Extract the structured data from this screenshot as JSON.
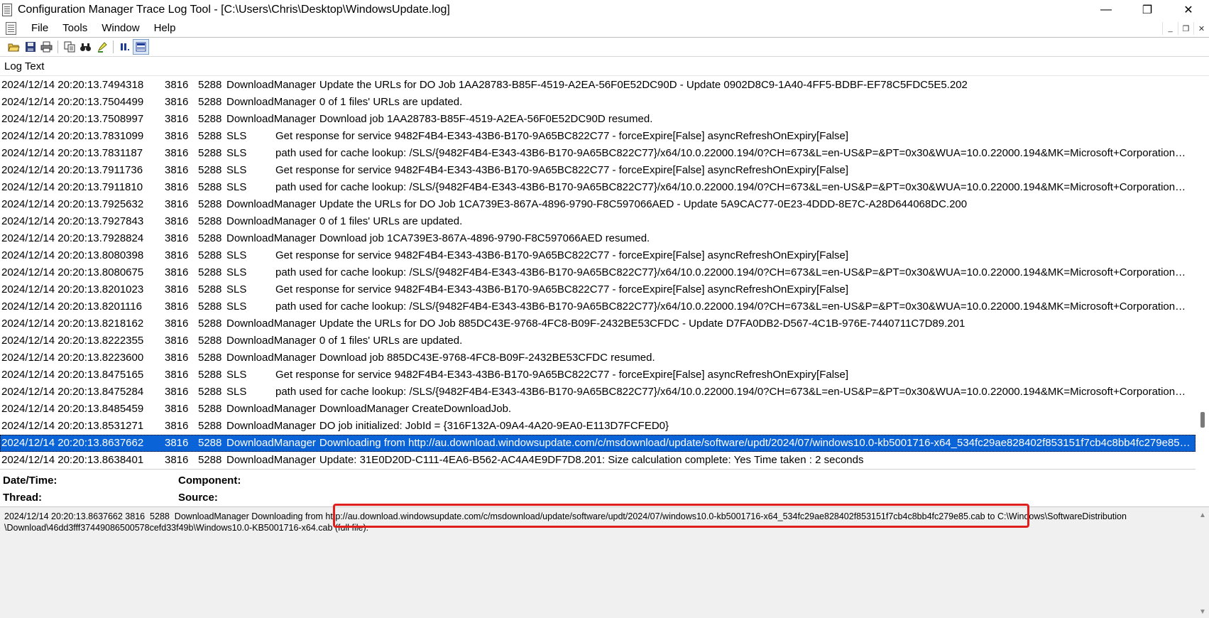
{
  "window": {
    "title": "Configuration Manager Trace Log Tool - [C:\\Users\\Chris\\Desktop\\WindowsUpdate.log]",
    "minimize": "—",
    "maximize": "❐",
    "close": "✕"
  },
  "menu": {
    "items": [
      "File",
      "Tools",
      "Window",
      "Help"
    ],
    "mdi_minimize": "_",
    "mdi_restore": "❐",
    "mdi_close": "✕"
  },
  "toolbar": {
    "icons": [
      "open-folder-icon",
      "save-icon",
      "print-icon",
      "copy-icon",
      "find-icon",
      "highlight-icon",
      "pause-icon",
      "details-pane-icon"
    ]
  },
  "log": {
    "header": "Log Text",
    "rows": [
      {
        "dt": "2024/12/14 20:20:13.7494318",
        "th": "3816",
        "pid": "5288",
        "comp": "DownloadManager",
        "text": "Update the URLs for DO Job 1AA28783-B85F-4519-A2EA-56F0E52DC90D - Update 0902D8C9-1A40-4FF5-BDBF-EF78C5FDC5E5.202"
      },
      {
        "dt": "2024/12/14 20:20:13.7504499",
        "th": "3816",
        "pid": "5288",
        "comp": "DownloadManager",
        "text": "0 of 1 files' URLs are updated."
      },
      {
        "dt": "2024/12/14 20:20:13.7508997",
        "th": "3816",
        "pid": "5288",
        "comp": "DownloadManager",
        "text": "Download job 1AA28783-B85F-4519-A2EA-56F0E52DC90D resumed."
      },
      {
        "dt": "2024/12/14 20:20:13.7831099",
        "th": "3816",
        "pid": "5288",
        "comp": "SLS",
        "text": "Get response for service 9482F4B4-E343-43B6-B170-9A65BC822C77 - forceExpire[False] asyncRefreshOnExpiry[False]"
      },
      {
        "dt": "2024/12/14 20:20:13.7831187",
        "th": "3816",
        "pid": "5288",
        "comp": "SLS",
        "text": "path used for cache lookup: /SLS/{9482F4B4-E343-43B6-B170-9A65BC822C77}/x64/10.0.22000.194/0?CH=673&L=en-US&P=&PT=0x30&WUA=10.0.22000.194&MK=Microsoft+Corporation&MD=Virtual+Machine"
      },
      {
        "dt": "2024/12/14 20:20:13.7911736",
        "th": "3816",
        "pid": "5288",
        "comp": "SLS",
        "text": "Get response for service 9482F4B4-E343-43B6-B170-9A65BC822C77 - forceExpire[False] asyncRefreshOnExpiry[False]"
      },
      {
        "dt": "2024/12/14 20:20:13.7911810",
        "th": "3816",
        "pid": "5288",
        "comp": "SLS",
        "text": "path used for cache lookup: /SLS/{9482F4B4-E343-43B6-B170-9A65BC822C77}/x64/10.0.22000.194/0?CH=673&L=en-US&P=&PT=0x30&WUA=10.0.22000.194&MK=Microsoft+Corporation&MD=Virtual+Machine"
      },
      {
        "dt": "2024/12/14 20:20:13.7925632",
        "th": "3816",
        "pid": "5288",
        "comp": "DownloadManager",
        "text": "Update the URLs for DO Job 1CA739E3-867A-4896-9790-F8C597066AED - Update 5A9CAC77-0E23-4DDD-8E7C-A28D644068DC.200"
      },
      {
        "dt": "2024/12/14 20:20:13.7927843",
        "th": "3816",
        "pid": "5288",
        "comp": "DownloadManager",
        "text": "0 of 1 files' URLs are updated."
      },
      {
        "dt": "2024/12/14 20:20:13.7928824",
        "th": "3816",
        "pid": "5288",
        "comp": "DownloadManager",
        "text": "Download job 1CA739E3-867A-4896-9790-F8C597066AED resumed."
      },
      {
        "dt": "2024/12/14 20:20:13.8080398",
        "th": "3816",
        "pid": "5288",
        "comp": "SLS",
        "text": "Get response for service 9482F4B4-E343-43B6-B170-9A65BC822C77 - forceExpire[False] asyncRefreshOnExpiry[False]"
      },
      {
        "dt": "2024/12/14 20:20:13.8080675",
        "th": "3816",
        "pid": "5288",
        "comp": "SLS",
        "text": "path used for cache lookup: /SLS/{9482F4B4-E343-43B6-B170-9A65BC822C77}/x64/10.0.22000.194/0?CH=673&L=en-US&P=&PT=0x30&WUA=10.0.22000.194&MK=Microsoft+Corporation&MD=Virtual+Machine"
      },
      {
        "dt": "2024/12/14 20:20:13.8201023",
        "th": "3816",
        "pid": "5288",
        "comp": "SLS",
        "text": "Get response for service 9482F4B4-E343-43B6-B170-9A65BC822C77 - forceExpire[False] asyncRefreshOnExpiry[False]"
      },
      {
        "dt": "2024/12/14 20:20:13.8201116",
        "th": "3816",
        "pid": "5288",
        "comp": "SLS",
        "text": "path used for cache lookup: /SLS/{9482F4B4-E343-43B6-B170-9A65BC822C77}/x64/10.0.22000.194/0?CH=673&L=en-US&P=&PT=0x30&WUA=10.0.22000.194&MK=Microsoft+Corporation&MD=Virtual+Machine"
      },
      {
        "dt": "2024/12/14 20:20:13.8218162",
        "th": "3816",
        "pid": "5288",
        "comp": "DownloadManager",
        "text": "Update the URLs for DO Job 885DC43E-9768-4FC8-B09F-2432BE53CFDC - Update D7FA0DB2-D567-4C1B-976E-7440711C7D89.201"
      },
      {
        "dt": "2024/12/14 20:20:13.8222355",
        "th": "3816",
        "pid": "5288",
        "comp": "DownloadManager",
        "text": "0 of 1 files' URLs are updated."
      },
      {
        "dt": "2024/12/14 20:20:13.8223600",
        "th": "3816",
        "pid": "5288",
        "comp": "DownloadManager",
        "text": "Download job 885DC43E-9768-4FC8-B09F-2432BE53CFDC resumed."
      },
      {
        "dt": "2024/12/14 20:20:13.8475165",
        "th": "3816",
        "pid": "5288",
        "comp": "SLS",
        "text": "Get response for service 9482F4B4-E343-43B6-B170-9A65BC822C77 - forceExpire[False] asyncRefreshOnExpiry[False]"
      },
      {
        "dt": "2024/12/14 20:20:13.8475284",
        "th": "3816",
        "pid": "5288",
        "comp": "SLS",
        "text": "path used for cache lookup: /SLS/{9482F4B4-E343-43B6-B170-9A65BC822C77}/x64/10.0.22000.194/0?CH=673&L=en-US&P=&PT=0x30&WUA=10.0.22000.194&MK=Microsoft+Corporation&MD=Virtual+Machine"
      },
      {
        "dt": "2024/12/14 20:20:13.8485459",
        "th": "3816",
        "pid": "5288",
        "comp": "DownloadManager",
        "text": "DownloadManager CreateDownloadJob."
      },
      {
        "dt": "2024/12/14 20:20:13.8531271",
        "th": "3816",
        "pid": "5288",
        "comp": "DownloadManager",
        "text": "DO job initialized: JobId = {316F132A-09A4-4A20-9EA0-E113D7FCFED0}"
      },
      {
        "dt": "2024/12/14 20:20:13.8637662",
        "th": "3816",
        "pid": "5288",
        "comp": "DownloadManager",
        "text": "Downloading from http://au.download.windowsupdate.com/c/msdownload/update/software/updt/2024/07/windows10.0-kb5001716-x64_534fc29ae828402f853151f7cb4c8bb4fc279e85.cab to C:\\Windows\\SoftwareDistribution\\Download",
        "selected": true
      },
      {
        "dt": "2024/12/14 20:20:13.8638401",
        "th": "3816",
        "pid": "5288",
        "comp": "DownloadManager",
        "text": "Update: 31E0D20D-C111-4EA6-B562-AC4A4E9DF7D8.201: Size calculation complete: Yes Time taken : 2 seconds"
      }
    ]
  },
  "details": {
    "datetime_label": "Date/Time:",
    "component_label": "Component:",
    "thread_label": "Thread:",
    "source_label": "Source:",
    "text": "2024/12/14 20:20:13.8637662 3816  5288  DownloadManager Downloading from http://au.download.windowsupdate.com/c/msdownload/update/software/updt/2024/07/windows10.0-kb5001716-x64_534fc29ae828402f853151f7cb4c8bb4fc279e85.cab to C:\\Windows\\SoftwareDistribution\n\\Download\\46dd3fff37449086500578cefd33f49b\\Windows10.0-KB5001716-x64.cab (full file)."
  },
  "colors": {
    "selection": "#0a64d8",
    "annotation": "#e01e1e"
  }
}
